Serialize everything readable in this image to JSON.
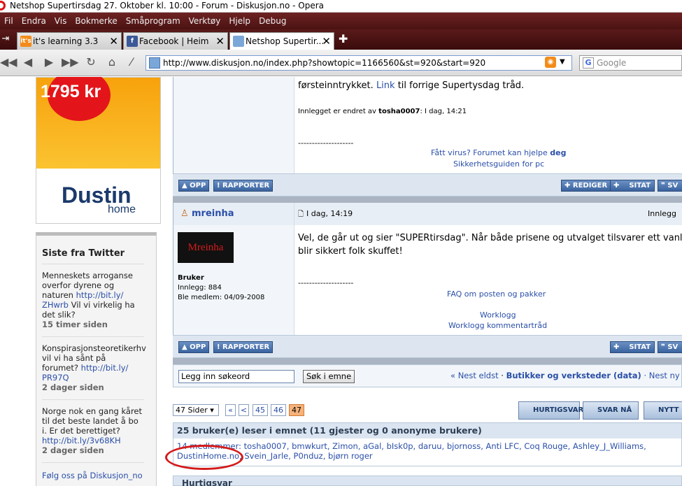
{
  "window": {
    "title": "Netshop Supertirsdag 27. Oktober kl. 10:00 - Forum - Diskusjon.no - Opera"
  },
  "menu": [
    "Fil",
    "Endra",
    "Vis",
    "Bokmerke",
    "Småprogram",
    "Verktøy",
    "Hjelp",
    "Debug"
  ],
  "tabs": [
    {
      "label": "it's learning 3.3",
      "favicon": "it's",
      "color": "#f38b1a"
    },
    {
      "label": "Facebook | Heim",
      "favicon": "f",
      "color": "#3b5998"
    },
    {
      "label": "Netshop Supertir...",
      "favicon": "",
      "color": "#7aa7d8"
    }
  ],
  "address": {
    "url": "http://www.diskusjon.no/index.php?showtopic=1166560&st=920&start=920"
  },
  "search": {
    "placeholder": "Google"
  },
  "ad": {
    "price": "1795 kr",
    "brand": "Dustin",
    "sub": "home"
  },
  "twitter": {
    "heading": "Siste fra Twitter",
    "items": [
      {
        "text": "Menneskets arroganse overfor dyrene og naturen",
        "link": "http://bit.ly/ ZHwrb",
        "rest": "Vil vi virkelig ha det slik?",
        "when": "15 timer siden"
      },
      {
        "text": "Konspirasjonsteoretikerhv vil vi ha sånt på forumet?",
        "link": "http://bit.ly/ PR97Q",
        "rest": "",
        "when": "2 dager siden"
      },
      {
        "text": "Norge nok en gang kåret til det beste landet å bo i. Er det berettiget?",
        "link": "http://bit.ly/3v68KH",
        "rest": "",
        "when": "2 dager siden"
      }
    ],
    "footer": "Følg oss på Diskusjon_no"
  },
  "post1": {
    "text_tail": "førsteinntrykket.",
    "link": "Link",
    "text_rest": "til forrige Supertysdag tråd.",
    "edited_prefix": "Innlegget er endret av",
    "edited_by": "tosha0007",
    "edited_when": ": I dag, 14:21",
    "sig_dash": "--------------------",
    "sig_line1": "Fått virus? Forumet kan hjelpe",
    "sig_line1_bold": "deg",
    "sig_line2": "Sikkerhetsguiden for pc"
  },
  "buttons": {
    "up": "OPP",
    "report": "RAPPORTER",
    "edit": "REDIGER",
    "quote": "SITAT",
    "reply": "SV"
  },
  "post2": {
    "author": "mreinha",
    "avatar_text": "Mreinha",
    "date": "I dag, 14:19",
    "right_label": "Innlegg",
    "role": "Bruker",
    "posts": "Innlegg: 884",
    "member_since": "Ble medlem: 04/09-2008",
    "body_line1": "Vel, de går ut og sier \"SUPERtirsdag\". Når både prisene og utvalget tilsvarer ett vanlig",
    "body_line2": "blir sikkert folk skuffet!",
    "sig_dash": "--------------------",
    "sig_line1": "FAQ om posten og pakker",
    "sig_line2": "Worklogg",
    "sig_line3": "Worklogg kommentartråd"
  },
  "searchbar": {
    "input_value": "Legg inn søkeord",
    "button": "Søk i emne",
    "nav_prev": "« Nest eldst",
    "forum": "Butikker og verksteder (data)",
    "nav_next": "· Nest ny"
  },
  "pagination": {
    "pages_label": "47 Sider ▾",
    "first": "«",
    "prev": "<",
    "p1": "45",
    "p2": "46",
    "current": "47"
  },
  "actions": {
    "quick": "HURTIGSVAR",
    "reply": "SVAR NÅ",
    "new": "NYTT"
  },
  "readers": {
    "header": "25 bruker(e) leser i emnet (11 gjester og 0 anonyme brukere)",
    "line1": "14 medlemmer: tosha0007, bmwkurt, Zimon, aGal, bIsk0p, daruu, bjornoss, Anti LFC, Coq Rouge, Ashley_J_Williams,",
    "line2": "DustinHome.no, Svein_Jarle, P0nduz, bjørn roger"
  },
  "quickreply": {
    "title": "Hurtigsvar"
  }
}
